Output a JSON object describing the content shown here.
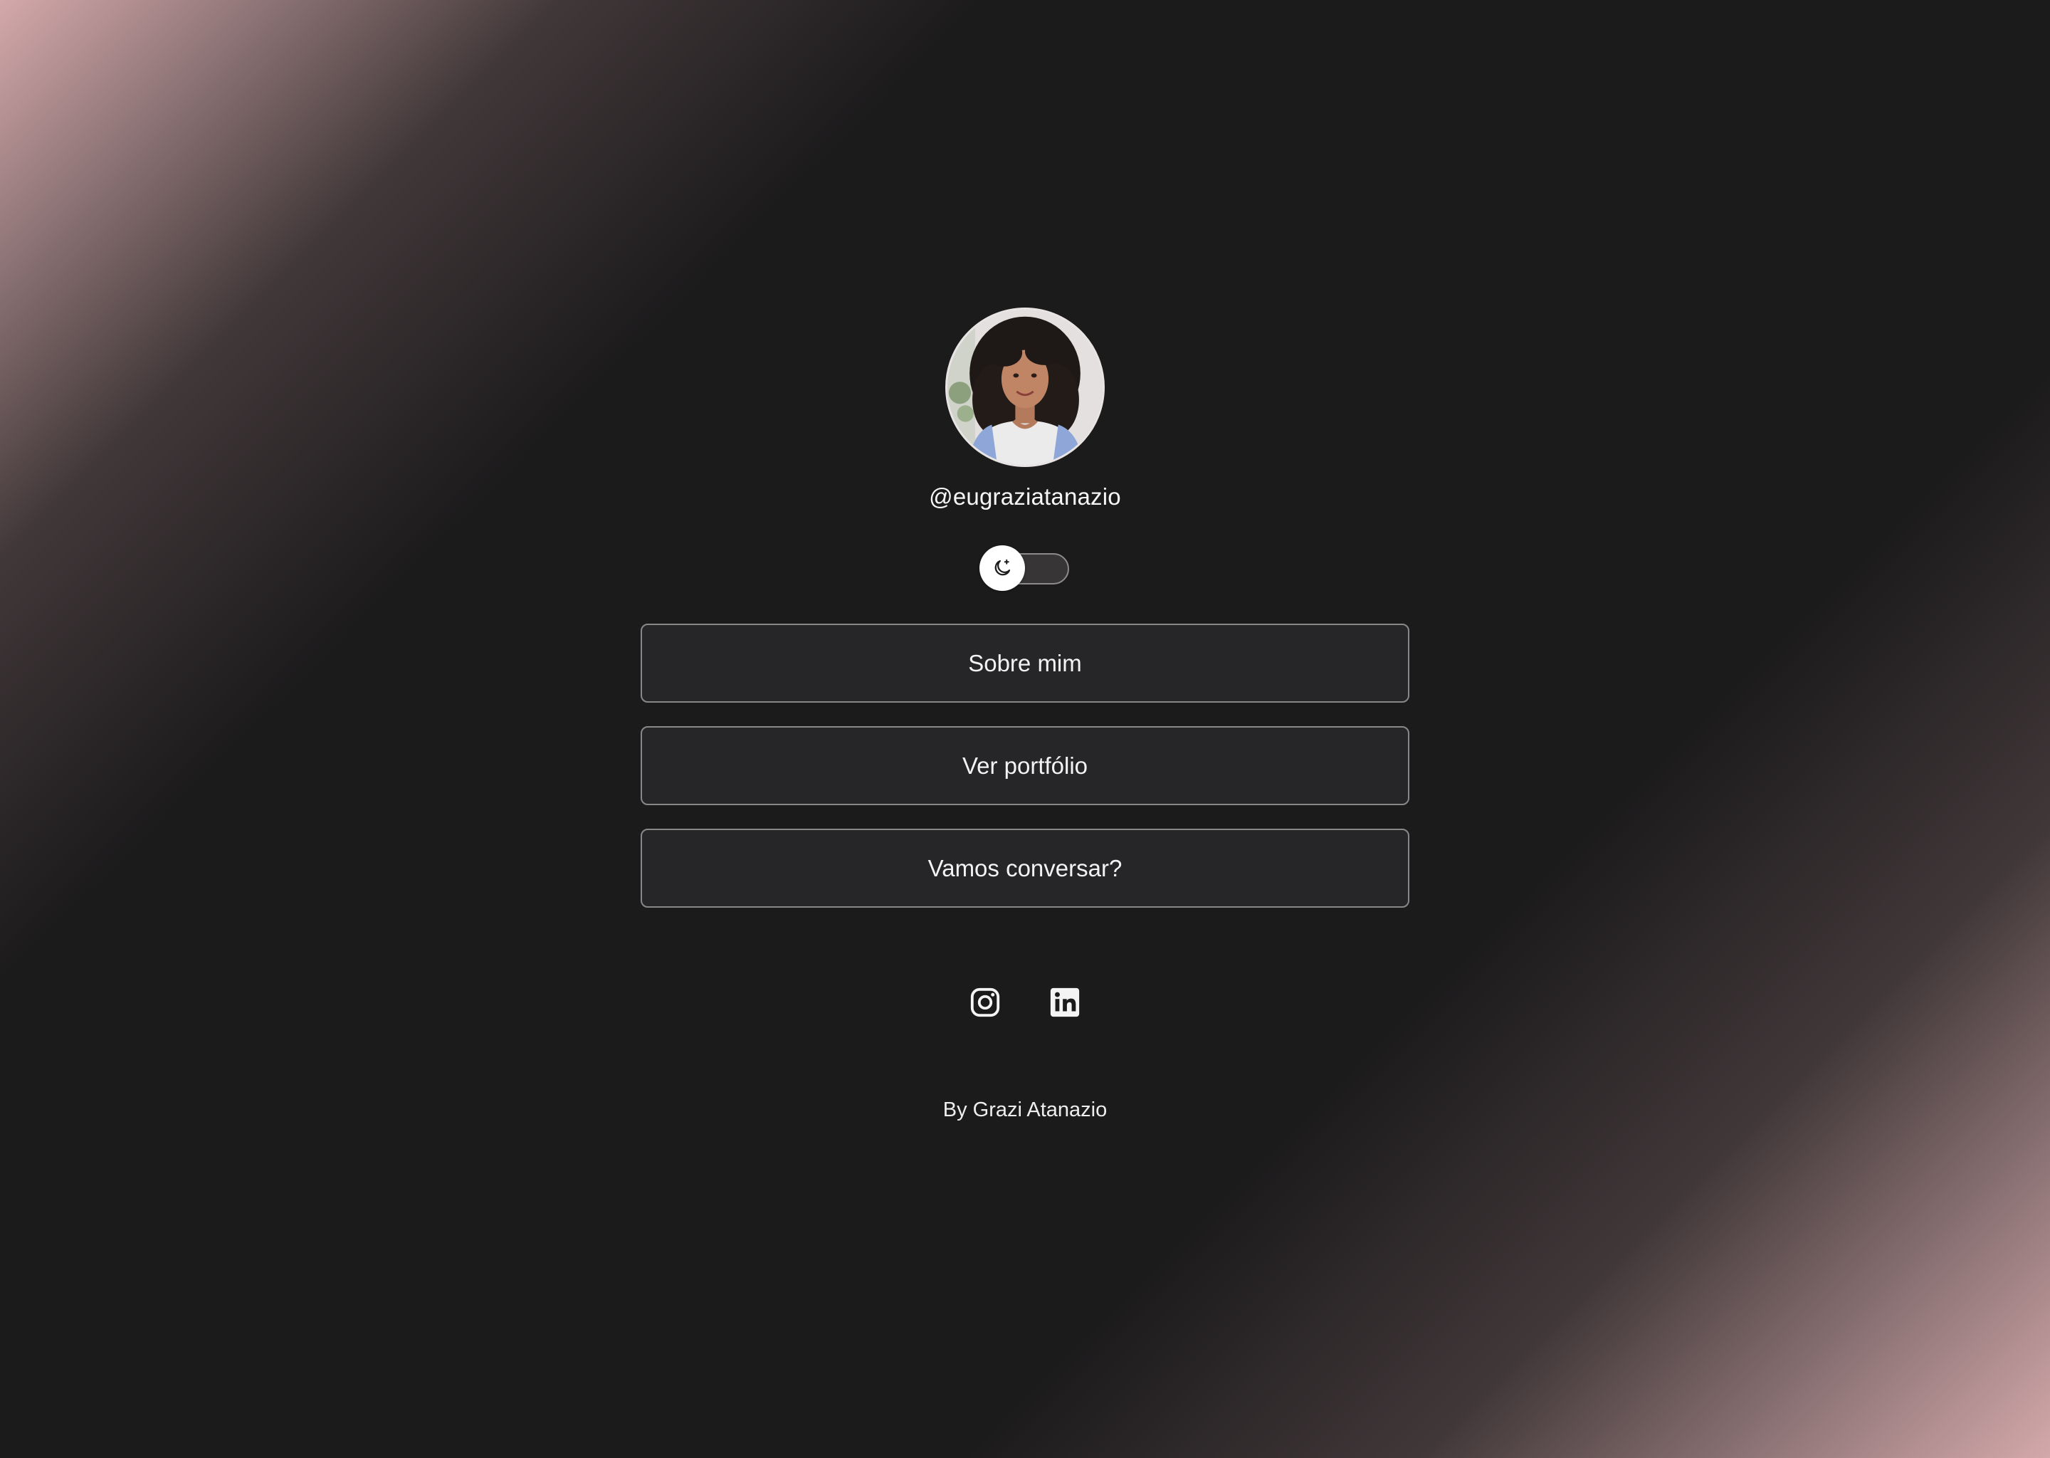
{
  "profile": {
    "handle": "@eugraziatanazio",
    "avatar_icon": "profile-photo"
  },
  "theme_toggle": {
    "icon": "moon-icon",
    "state": "dark"
  },
  "links": [
    {
      "label": "Sobre mim"
    },
    {
      "label": "Ver portfólio"
    },
    {
      "label": "Vamos conversar?"
    }
  ],
  "socials": [
    {
      "icon": "instagram-icon"
    },
    {
      "icon": "linkedin-icon"
    }
  ],
  "footer": {
    "text": "By Grazi Atanazio"
  },
  "colors": {
    "background": "#1c1b1c",
    "glow": "#deb0b2",
    "button_bg": "#262527",
    "button_border": "#8a8789",
    "text": "#f4f4f4"
  }
}
